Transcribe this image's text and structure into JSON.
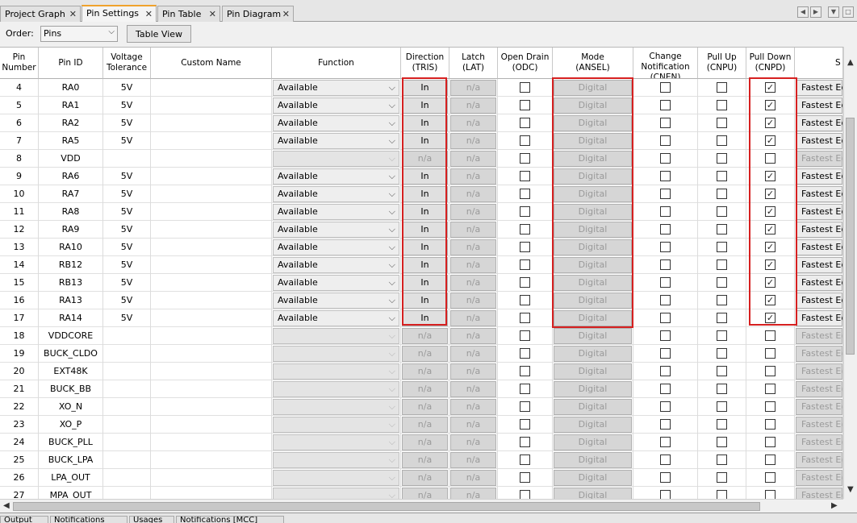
{
  "tabs": [
    {
      "label": "Project Graph",
      "active": false
    },
    {
      "label": "Pin Settings",
      "active": true
    },
    {
      "label": "Pin Table",
      "active": false
    },
    {
      "label": "Pin Diagram",
      "active": false
    }
  ],
  "toolbar": {
    "order_label": "Order:",
    "order_value": "Pins",
    "table_view_label": "Table View"
  },
  "columns": [
    {
      "key": "pin",
      "label": "Pin\nNumber"
    },
    {
      "key": "id",
      "label": "Pin ID"
    },
    {
      "key": "volt",
      "label": "Voltage\nTolerance"
    },
    {
      "key": "custom",
      "label": "Custom Name"
    },
    {
      "key": "func",
      "label": "Function"
    },
    {
      "key": "dir",
      "label": "Direction\n(TRIS)"
    },
    {
      "key": "latch",
      "label": "Latch\n(LAT)"
    },
    {
      "key": "odc",
      "label": "Open Drain\n(ODC)"
    },
    {
      "key": "mode",
      "label": "Mode\n(ANSEL)"
    },
    {
      "key": "cn",
      "label": "Change\nNotification\n(CNEN)"
    },
    {
      "key": "pu",
      "label": "Pull Up\n(CNPU)"
    },
    {
      "key": "pd",
      "label": "Pull Down\n(CNPD)"
    },
    {
      "key": "slew",
      "label": "S"
    }
  ],
  "rows": [
    {
      "pin": "4",
      "id": "RA0",
      "volt": "5V",
      "func": "Available",
      "dir": "In",
      "latch": "n/a",
      "mode": "Digital",
      "pd": true,
      "slew": "Fastest Ec",
      "enabled": true
    },
    {
      "pin": "5",
      "id": "RA1",
      "volt": "5V",
      "func": "Available",
      "dir": "In",
      "latch": "n/a",
      "mode": "Digital",
      "pd": true,
      "slew": "Fastest Ec",
      "enabled": true
    },
    {
      "pin": "6",
      "id": "RA2",
      "volt": "5V",
      "func": "Available",
      "dir": "In",
      "latch": "n/a",
      "mode": "Digital",
      "pd": true,
      "slew": "Fastest Ec",
      "enabled": true
    },
    {
      "pin": "7",
      "id": "RA5",
      "volt": "5V",
      "func": "Available",
      "dir": "In",
      "latch": "n/a",
      "mode": "Digital",
      "pd": true,
      "slew": "Fastest Ec",
      "enabled": true
    },
    {
      "pin": "8",
      "id": "VDD",
      "volt": "",
      "func": "",
      "dir": "n/a",
      "latch": "n/a",
      "mode": "Digital",
      "pd": false,
      "slew": "Fastest Ec",
      "enabled": false
    },
    {
      "pin": "9",
      "id": "RA6",
      "volt": "5V",
      "func": "Available",
      "dir": "In",
      "latch": "n/a",
      "mode": "Digital",
      "pd": true,
      "slew": "Fastest Ec",
      "enabled": true
    },
    {
      "pin": "10",
      "id": "RA7",
      "volt": "5V",
      "func": "Available",
      "dir": "In",
      "latch": "n/a",
      "mode": "Digital",
      "pd": true,
      "slew": "Fastest Ec",
      "enabled": true
    },
    {
      "pin": "11",
      "id": "RA8",
      "volt": "5V",
      "func": "Available",
      "dir": "In",
      "latch": "n/a",
      "mode": "Digital",
      "pd": true,
      "slew": "Fastest Ec",
      "enabled": true
    },
    {
      "pin": "12",
      "id": "RA9",
      "volt": "5V",
      "func": "Available",
      "dir": "In",
      "latch": "n/a",
      "mode": "Digital",
      "pd": true,
      "slew": "Fastest Ec",
      "enabled": true
    },
    {
      "pin": "13",
      "id": "RA10",
      "volt": "5V",
      "func": "Available",
      "dir": "In",
      "latch": "n/a",
      "mode": "Digital",
      "pd": true,
      "slew": "Fastest Ec",
      "enabled": true
    },
    {
      "pin": "14",
      "id": "RB12",
      "volt": "5V",
      "func": "Available",
      "dir": "In",
      "latch": "n/a",
      "mode": "Digital",
      "pd": true,
      "slew": "Fastest Ec",
      "enabled": true
    },
    {
      "pin": "15",
      "id": "RB13",
      "volt": "5V",
      "func": "Available",
      "dir": "In",
      "latch": "n/a",
      "mode": "Digital",
      "pd": true,
      "slew": "Fastest Ec",
      "enabled": true
    },
    {
      "pin": "16",
      "id": "RA13",
      "volt": "5V",
      "func": "Available",
      "dir": "In",
      "latch": "n/a",
      "mode": "Digital",
      "pd": true,
      "slew": "Fastest Ec",
      "enabled": true
    },
    {
      "pin": "17",
      "id": "RA14",
      "volt": "5V",
      "func": "Available",
      "dir": "In",
      "latch": "n/a",
      "mode": "Digital",
      "pd": true,
      "slew": "Fastest Ec",
      "enabled": true
    },
    {
      "pin": "18",
      "id": "VDDCORE",
      "volt": "",
      "func": "",
      "dir": "n/a",
      "latch": "n/a",
      "mode": "Digital",
      "pd": false,
      "slew": "Fastest Ec",
      "enabled": false
    },
    {
      "pin": "19",
      "id": "BUCK_CLDO",
      "volt": "",
      "func": "",
      "dir": "n/a",
      "latch": "n/a",
      "mode": "Digital",
      "pd": false,
      "slew": "Fastest Ec",
      "enabled": false
    },
    {
      "pin": "20",
      "id": "EXT48K",
      "volt": "",
      "func": "",
      "dir": "n/a",
      "latch": "n/a",
      "mode": "Digital",
      "pd": false,
      "slew": "Fastest Ec",
      "enabled": false
    },
    {
      "pin": "21",
      "id": "BUCK_BB",
      "volt": "",
      "func": "",
      "dir": "n/a",
      "latch": "n/a",
      "mode": "Digital",
      "pd": false,
      "slew": "Fastest Ec",
      "enabled": false
    },
    {
      "pin": "22",
      "id": "XO_N",
      "volt": "",
      "func": "",
      "dir": "n/a",
      "latch": "n/a",
      "mode": "Digital",
      "pd": false,
      "slew": "Fastest Ec",
      "enabled": false
    },
    {
      "pin": "23",
      "id": "XO_P",
      "volt": "",
      "func": "",
      "dir": "n/a",
      "latch": "n/a",
      "mode": "Digital",
      "pd": false,
      "slew": "Fastest Ec",
      "enabled": false
    },
    {
      "pin": "24",
      "id": "BUCK_PLL",
      "volt": "",
      "func": "",
      "dir": "n/a",
      "latch": "n/a",
      "mode": "Digital",
      "pd": false,
      "slew": "Fastest Ec",
      "enabled": false
    },
    {
      "pin": "25",
      "id": "BUCK_LPA",
      "volt": "",
      "func": "",
      "dir": "n/a",
      "latch": "n/a",
      "mode": "Digital",
      "pd": false,
      "slew": "Fastest Ec",
      "enabled": false
    },
    {
      "pin": "26",
      "id": "LPA_OUT",
      "volt": "",
      "func": "",
      "dir": "n/a",
      "latch": "n/a",
      "mode": "Digital",
      "pd": false,
      "slew": "Fastest Ec",
      "enabled": false
    },
    {
      "pin": "27",
      "id": "MPA_OUT",
      "volt": "",
      "func": "",
      "dir": "n/a",
      "latch": "n/a",
      "mode": "Digital",
      "pd": false,
      "slew": "Fastest Ec",
      "enabled": false
    }
  ],
  "highlight_color": "#d62020",
  "bottom_tabs": [
    {
      "label": "Output"
    },
    {
      "label": "Notifications"
    },
    {
      "label": "Usages"
    },
    {
      "label": "Notifications [MCC]"
    }
  ]
}
